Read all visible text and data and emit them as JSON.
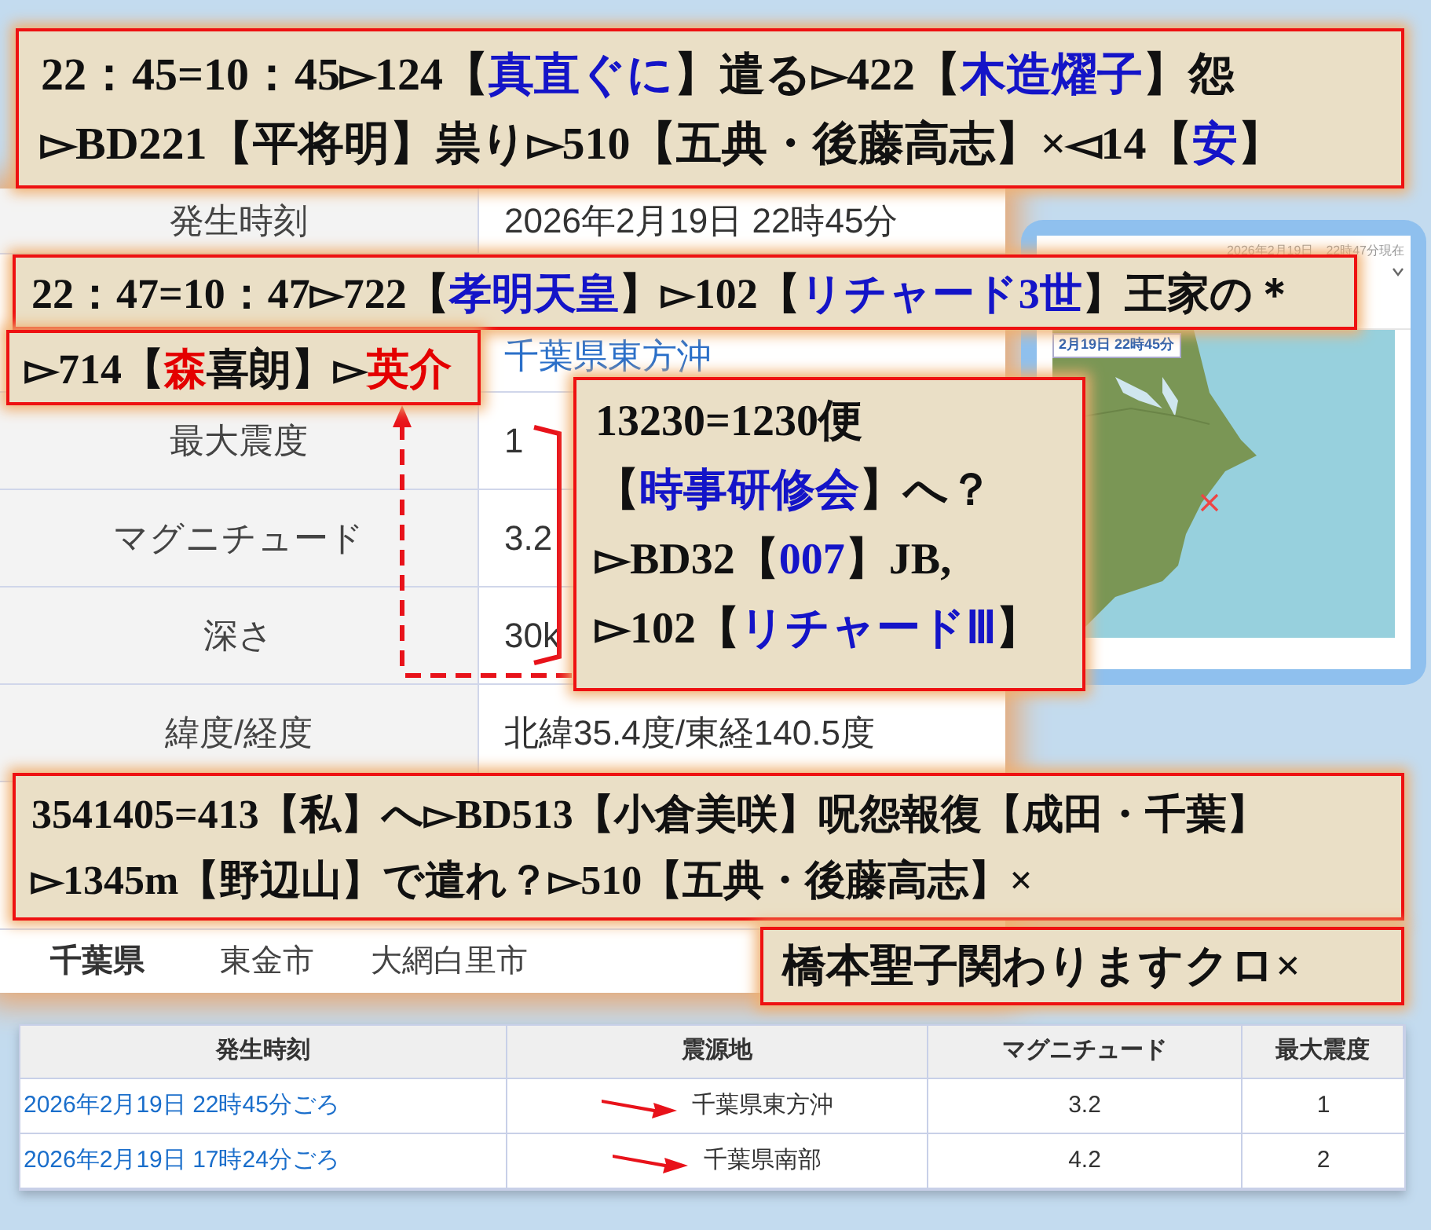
{
  "detail_panel": {
    "rows": [
      {
        "label": "発生時刻",
        "value": "2026年2月19日 22時45分",
        "kind": "text"
      },
      {
        "label": "",
        "value": "千葉県東方沖",
        "kind": "link"
      },
      {
        "label": "最大震度",
        "value": "1",
        "kind": "text"
      },
      {
        "label": "マグニチュード",
        "value": "3.2",
        "kind": "text"
      },
      {
        "label": "深さ",
        "value": "30k",
        "kind": "text"
      },
      {
        "label": "緯度/経度",
        "value": "北緯35.4度/東経140.5度",
        "kind": "text"
      }
    ],
    "region_row": {
      "prefecture": "千葉県",
      "cities": [
        "東金市",
        "大網白里市"
      ]
    }
  },
  "map_panel": {
    "header": "2026年2月19日　22時47分現在",
    "map_label": "2月19日 22時45分",
    "kind": "picture"
  },
  "quake_table": {
    "columns": [
      "発生時刻",
      "震源地",
      "マグニチュード",
      "最大震度"
    ],
    "rows": [
      {
        "time": "2026年2月19日 22時45分ごろ",
        "place": "千葉県東方沖",
        "magnitude": "3.2",
        "intensity": "1"
      },
      {
        "time": "2026年2月19日 17時24分ごろ",
        "place": "千葉県南部",
        "magnitude": "4.2",
        "intensity": "2"
      }
    ]
  },
  "callouts": [
    {
      "lines": [
        [
          {
            "text": "22：45=10：45▻124【"
          },
          {
            "text": "真直ぐに",
            "color": "#1414c8"
          },
          {
            "text": "】遣る▻422【"
          },
          {
            "text": "木造燿子",
            "color": "#1414c8"
          },
          {
            "text": "】怨"
          }
        ],
        [
          {
            "text": "▻BD221【平将明】祟り▻510【五典・後藤高志】×◅14【"
          },
          {
            "text": "安",
            "color": "#1414c8"
          },
          {
            "text": "】"
          }
        ]
      ]
    },
    {
      "lines": [
        [
          {
            "text": "22：47=10：47▻722【"
          },
          {
            "text": "孝明天皇",
            "color": "#1414c8"
          },
          {
            "text": "】▻102【"
          },
          {
            "text": "リチャード3世",
            "color": "#1414c8"
          },
          {
            "text": "】王家の＊"
          }
        ]
      ]
    },
    {
      "lines": [
        [
          {
            "text": "▻714【"
          },
          {
            "text": "森",
            "color": "#e40000"
          },
          {
            "text": "喜朗】▻"
          },
          {
            "text": "英介",
            "color": "#e40000"
          }
        ]
      ]
    },
    {
      "lines": [
        [
          {
            "text": "13230=1230便"
          }
        ],
        [
          {
            "text": "【"
          },
          {
            "text": "時事研修会",
            "color": "#1414c8"
          },
          {
            "text": "】へ？"
          }
        ],
        [
          {
            "text": "▻BD32【"
          },
          {
            "text": "007",
            "color": "#1414c8"
          },
          {
            "text": "】JB,"
          }
        ],
        [
          {
            "text": "▻102【"
          },
          {
            "text": "リチャードⅢ",
            "color": "#1414c8"
          },
          {
            "text": "】"
          }
        ]
      ]
    },
    {
      "lines": [
        [
          {
            "text": "3541405=413【私】へ▻BD513【小倉美咲】呪怨報復【成田・千葉】"
          }
        ],
        [
          {
            "text": "▻1345m【野辺山】で遣れ？▻510【五典・後藤高志】×"
          }
        ]
      ]
    },
    {
      "lines": [
        [
          {
            "text": "橋本聖子関わりますクロ×"
          }
        ]
      ]
    }
  ]
}
